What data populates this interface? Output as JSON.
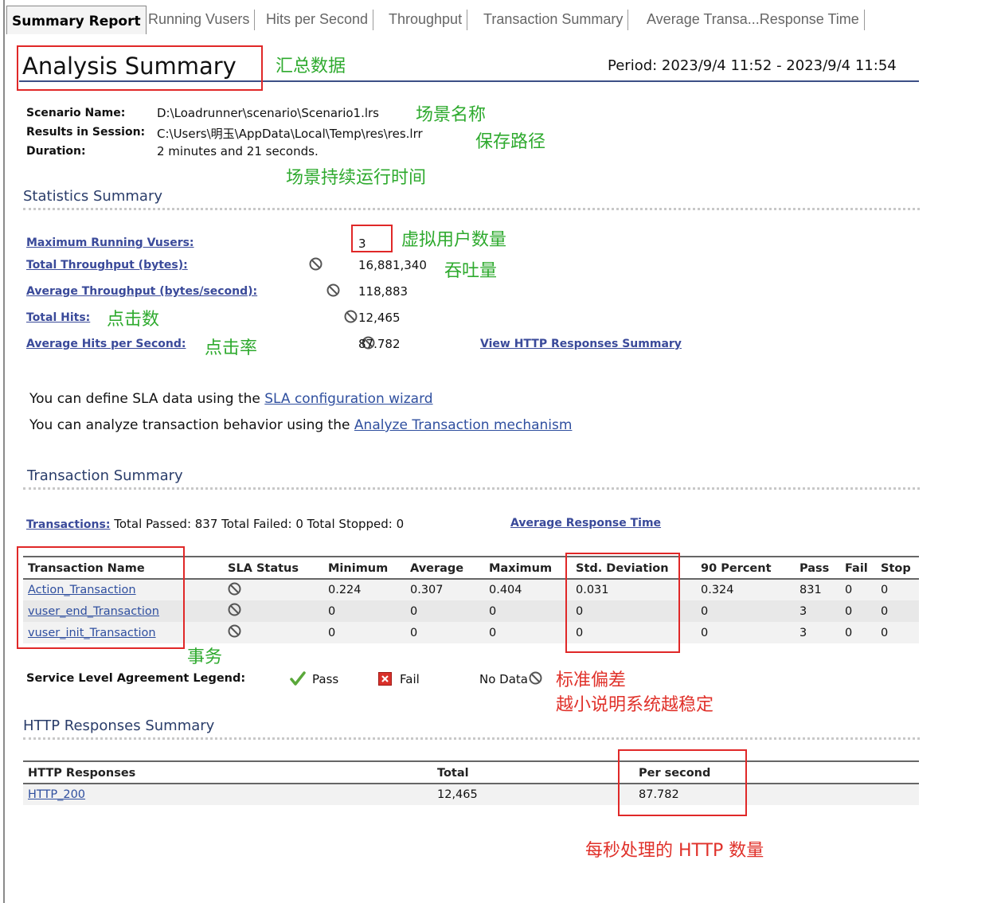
{
  "tabs": [
    {
      "label": "Summary Report",
      "active": true
    },
    {
      "label": "Running Vusers"
    },
    {
      "label": "Hits per Second"
    },
    {
      "label": "Throughput"
    },
    {
      "label": "Transaction Summary"
    },
    {
      "label": "Average Transa...Response Time"
    }
  ],
  "header": {
    "title": "Analysis Summary",
    "period": "Period: 2023/9/4 11:52 - 2023/9/4 11:54"
  },
  "scenario": {
    "name_label": "Scenario Name:",
    "name_value": "D:\\Loadrunner\\scenario\\Scenario1.lrs",
    "session_label": "Results in Session:",
    "session_value": "C:\\Users\\明玉\\AppData\\Local\\Temp\\res\\res.lrr",
    "duration_label": "Duration:",
    "duration_value": "2 minutes and 21 seconds."
  },
  "statistics": {
    "title": "Statistics Summary",
    "rows": [
      {
        "label": "Maximum Running Vusers:",
        "value": "3"
      },
      {
        "label": "Total Throughput (bytes):",
        "value": "16,881,340"
      },
      {
        "label": "Average Throughput (bytes/second):",
        "value": "118,883"
      },
      {
        "label": "Total Hits:",
        "value": "12,465"
      },
      {
        "label": "Average Hits per Second:",
        "value": "87.782"
      }
    ],
    "http_link": "View HTTP Responses Summary"
  },
  "sla": {
    "line1_text": "You can define SLA data using the",
    "line1_link": "SLA configuration wizard",
    "line2_text": "You can analyze transaction behavior using the",
    "line2_link": "Analyze Transaction mechanism"
  },
  "transactions": {
    "title": "Transaction Summary",
    "link": "Transactions:",
    "totals": "Total Passed: 837 Total Failed: 0 Total Stopped: 0",
    "avg_link": "Average Response Time",
    "columns": [
      "Transaction Name",
      "SLA Status",
      "Minimum",
      "Average",
      "Maximum",
      "Std. Deviation",
      "90 Percent",
      "Pass",
      "Fail",
      "Stop"
    ],
    "rows": [
      {
        "name": "Action_Transaction",
        "min": "0.224",
        "avg": "0.307",
        "max": "0.404",
        "std": "0.031",
        "p90": "0.324",
        "pass": "831",
        "fail": "0",
        "stop": "0"
      },
      {
        "name": "vuser_end_Transaction",
        "min": "0",
        "avg": "0",
        "max": "0",
        "std": "0",
        "p90": "0",
        "pass": "3",
        "fail": "0",
        "stop": "0"
      },
      {
        "name": "vuser_init_Transaction",
        "min": "0",
        "avg": "0",
        "max": "0",
        "std": "0",
        "p90": "0",
        "pass": "3",
        "fail": "0",
        "stop": "0"
      }
    ]
  },
  "legend": {
    "label": "Service Level Agreement Legend:",
    "pass": "Pass",
    "fail": "Fail",
    "nodata": "No Data"
  },
  "http": {
    "title": "HTTP Responses Summary",
    "columns": [
      "HTTP Responses",
      "Total",
      "Per second"
    ],
    "rows": [
      {
        "name": "HTTP_200",
        "total": "12,465",
        "per_second": "87.782"
      }
    ]
  },
  "annotations": {
    "summary": "汇总数据",
    "scenario_name": "场景名称",
    "save_path": "保存路径",
    "duration": "场景持续运行时间",
    "vusers": "虚拟用户数量",
    "throughput": "吞吐量",
    "hits": "点击数",
    "hits_rate": "点击率",
    "transaction": "事务",
    "std_line1": "标准偏差",
    "std_line2": "越小说明系统越稳定",
    "http_per_sec": "每秒处理的 HTTP 数量"
  },
  "colors": {
    "link": "#2f4f9f",
    "annotation_green": "#2eaa2e",
    "annotation_red": "#e0312a",
    "highlight_box": "#e02828"
  }
}
